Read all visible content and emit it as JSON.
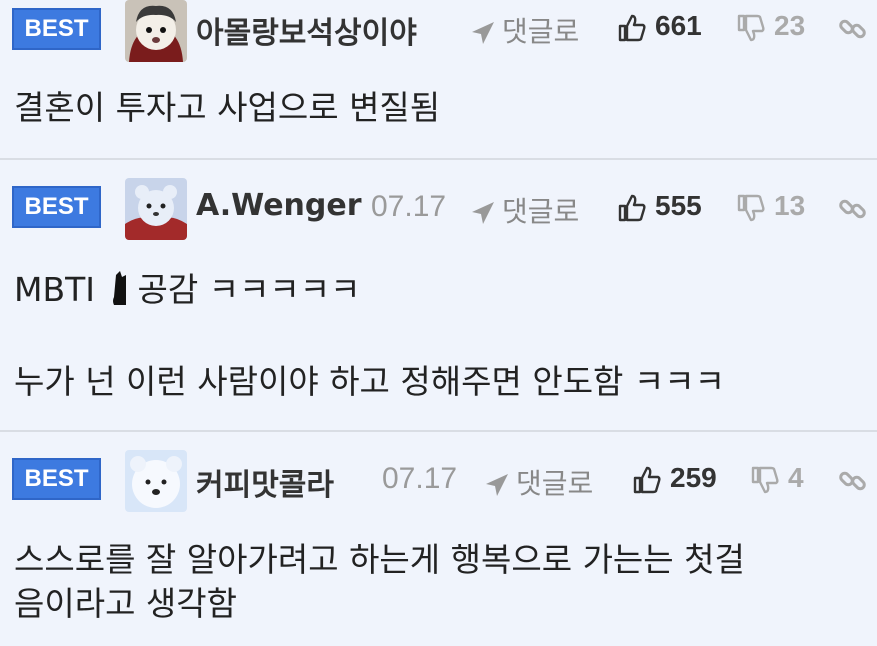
{
  "comments": [
    {
      "badge": "BEST",
      "nickname": "아몰랑보석상이야",
      "date": "",
      "reply_label": "댓글로",
      "likes": "661",
      "dislikes": "23",
      "lines": [
        "결혼이 투자고 사업으로 변질됨"
      ]
    },
    {
      "badge": "BEST",
      "nickname": "A.Wenger",
      "date": "07.17",
      "reply_label": "댓글로",
      "likes": "555",
      "dislikes": "13",
      "lines": [
        "MBTI ",
        "공감 ㅋㅋㅋㅋㅋ",
        "누가 넌 이런 사람이야 하고 정해주면 안도함 ㅋㅋㅋ"
      ]
    },
    {
      "badge": "BEST",
      "nickname": "커피맛콜라",
      "date": "07.17",
      "reply_label": "댓글로",
      "likes": "259",
      "dislikes": "4",
      "lines": [
        "스스로를 잘 알아가려고 하는게 행복으로 가는는 첫걸",
        "음이라고 생각함"
      ]
    }
  ],
  "colors": {
    "badge": "#3d7ae0",
    "background": "#f0f4fc",
    "divider": "#d9dde4"
  },
  "icons": [
    "avatar-dog",
    "reply-arrow-icon",
    "thumbs-up-icon",
    "thumbs-down-icon",
    "link-icon"
  ]
}
